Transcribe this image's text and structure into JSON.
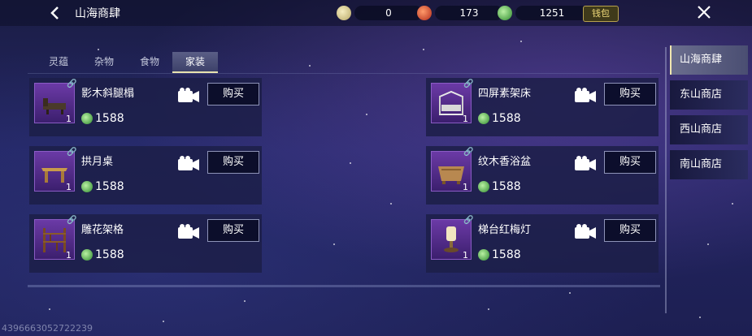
{
  "header": {
    "title": "山海商肆",
    "currencies": [
      {
        "icon": "jade-coin-icon",
        "value": "0"
      },
      {
        "icon": "red-gem-icon",
        "value": "173"
      },
      {
        "icon": "green-coin-icon",
        "value": "1251"
      }
    ],
    "wallet_label": "钱包"
  },
  "tabs": [
    "灵蕴",
    "杂物",
    "食物",
    "家装"
  ],
  "active_tab": "家装",
  "items": [
    {
      "name": "影木斜腿榻",
      "qty": "1",
      "price": "1588",
      "buy": "购买",
      "icon": "couch-icon"
    },
    {
      "name": "四屏素架床",
      "qty": "1",
      "price": "1588",
      "buy": "购买",
      "icon": "canopy-bed-icon"
    },
    {
      "name": "拱月桌",
      "qty": "1",
      "price": "1588",
      "buy": "购买",
      "icon": "table-icon"
    },
    {
      "name": "纹木香浴盆",
      "qty": "1",
      "price": "1588",
      "buy": "购买",
      "icon": "bathtub-icon"
    },
    {
      "name": "雕花架格",
      "qty": "1",
      "price": "1588",
      "buy": "购买",
      "icon": "shelf-icon"
    },
    {
      "name": "梯台红梅灯",
      "qty": "1",
      "price": "1588",
      "buy": "购买",
      "icon": "lamp-icon"
    }
  ],
  "shops": [
    "山海商肆",
    "东山商店",
    "西山商店",
    "南山商店"
  ],
  "active_shop": "山海商肆",
  "uid": "4396663052722239",
  "colors": {
    "accent_gold": "#e8e2b0",
    "panel": "#1c1e48",
    "item_bg": "#6b3aa6"
  }
}
